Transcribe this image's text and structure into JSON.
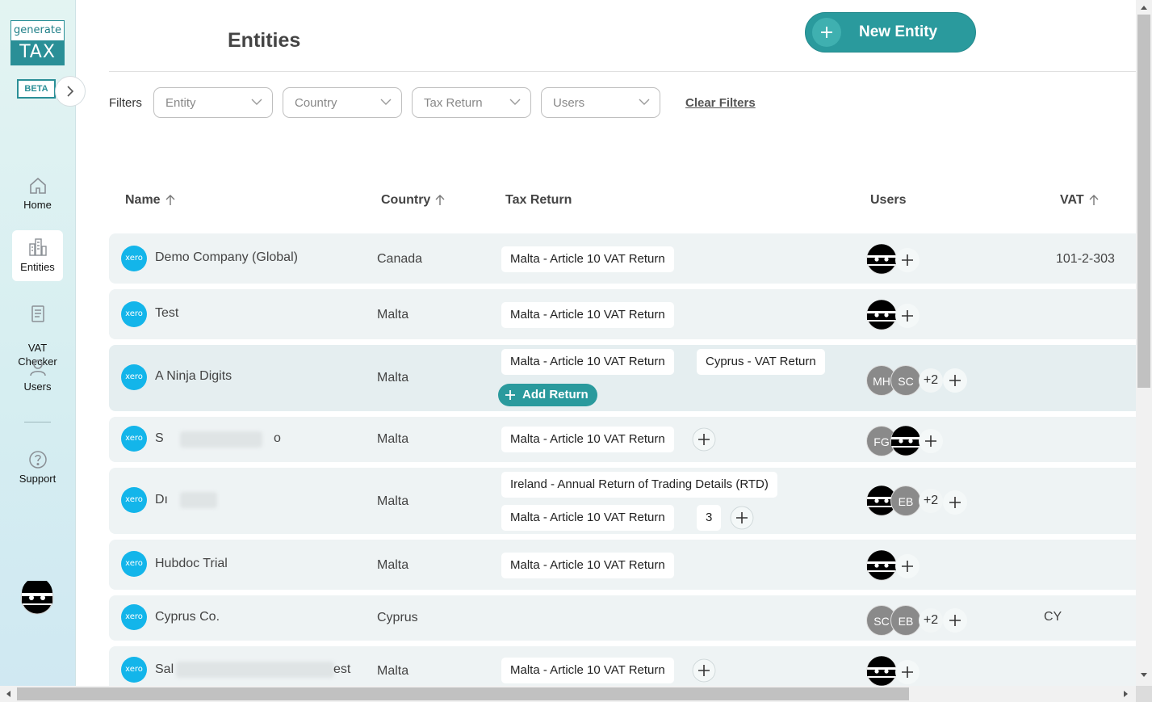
{
  "app": {
    "logo_top": "generate",
    "logo_bottom": "TAX",
    "beta_label": "BETA"
  },
  "sidebar": {
    "items": [
      {
        "label": "Home",
        "icon": "home-icon"
      },
      {
        "label": "Entities",
        "icon": "buildings-icon"
      },
      {
        "label": "VAT\nChecker",
        "icon": "document-icon"
      },
      {
        "label": "Users",
        "icon": "user-icon"
      },
      {
        "label": "Support",
        "icon": "help-icon"
      }
    ]
  },
  "header": {
    "title": "Entities",
    "new_entity_label": "New Entity"
  },
  "filters": {
    "label": "Filters",
    "entity_placeholder": "Entity",
    "country_placeholder": "Country",
    "tax_return_placeholder": "Tax Return",
    "users_placeholder": "Users",
    "clear_label": "Clear Filters"
  },
  "table": {
    "headers": {
      "name": "Name",
      "country": "Country",
      "tax_return": "Tax Return",
      "users": "Users",
      "vat": "VAT"
    },
    "xero_label": "xero",
    "add_return_label": "Add Return",
    "rows": [
      {
        "name": "Demo Company (Global)",
        "country": "Canada",
        "returns": [
          "Malta - Article 10 VAT Return"
        ],
        "vat": "101-2-303"
      },
      {
        "name": "Test",
        "country": "Malta",
        "returns": [
          "Malta - Article 10 VAT Return"
        ],
        "vat": ""
      },
      {
        "name": "A Ninja Digits",
        "country": "Malta",
        "returns": [
          "Malta - Article 10 VAT Return",
          "Cyprus - VAT Return"
        ],
        "users": [
          "MH",
          "SC"
        ],
        "more": "+2",
        "vat": ""
      },
      {
        "name_start": "S",
        "name_end": "o",
        "country": "Malta",
        "returns": [
          "Malta - Article 10 VAT Return"
        ],
        "users": [
          "FG"
        ],
        "vat": ""
      },
      {
        "name_start": "Dı",
        "country": "Malta",
        "returns": [
          "Ireland - Annual Return of Trading Details (RTD)",
          "Malta - Article 10 VAT Return"
        ],
        "extra_count": "3",
        "users": [
          "EB"
        ],
        "more": "+2",
        "vat": ""
      },
      {
        "name": "Hubdoc Trial",
        "country": "Malta",
        "returns": [
          "Malta - Article 10 VAT Return"
        ],
        "vat": ""
      },
      {
        "name": "Cyprus Co.",
        "country": "Cyprus",
        "returns": [],
        "users": [
          "SC",
          "EB"
        ],
        "more": "+2",
        "vat": "CY"
      },
      {
        "name_start": "Sal",
        "name_end": "est",
        "country": "Malta",
        "returns": [
          "Malta - Article 10 VAT Return"
        ],
        "vat": ""
      }
    ]
  }
}
